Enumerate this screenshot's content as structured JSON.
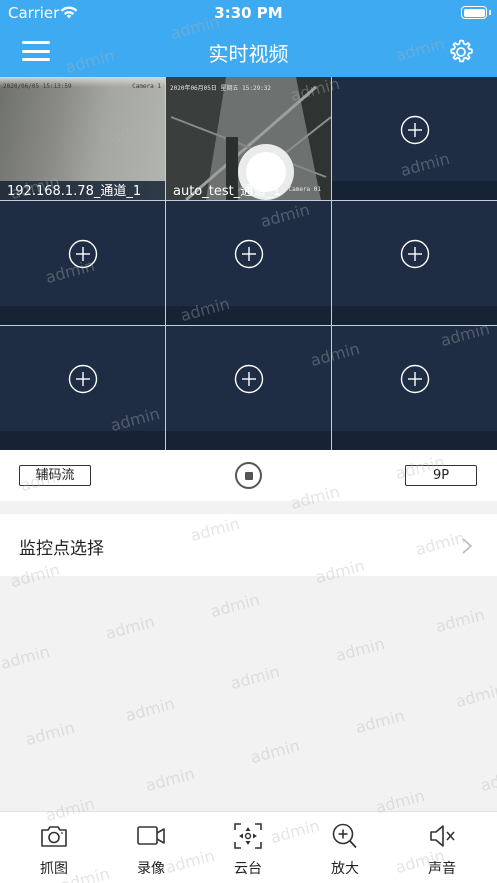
{
  "status_bar": {
    "carrier": "Carrier",
    "time": "3:30 PM"
  },
  "nav": {
    "title": "实时视频",
    "menu_icon": "hamburger-menu-icon",
    "settings_icon": "gear-icon"
  },
  "colors": {
    "accent": "#3daaf2",
    "cell_bg": "#1e2d44",
    "cell_band": "#162335"
  },
  "grid": {
    "layout": "3x3",
    "cells": [
      {
        "label": "192.168.1.78_通道_1",
        "osd_time": "2020/06/05 15:13:59",
        "osd_cam": "Camera 1"
      },
      {
        "label": "auto_test_通道_1",
        "osd_time": "2020年06月05日 星期五 15:29:32",
        "osd_cam": "Camera 01",
        "selected": true
      },
      {
        "label": ""
      },
      {
        "label": ""
      },
      {
        "label": ""
      },
      {
        "label": ""
      },
      {
        "label": ""
      },
      {
        "label": ""
      },
      {
        "label": ""
      }
    ]
  },
  "controls": {
    "stream_label": "辅码流",
    "layout_label": "9P"
  },
  "select_row": {
    "label": "监控点选择"
  },
  "watermark": "admin",
  "toolbar": {
    "capture": "抓图",
    "record": "录像",
    "ptz": "云台",
    "zoom": "放大",
    "sound": "声音"
  }
}
